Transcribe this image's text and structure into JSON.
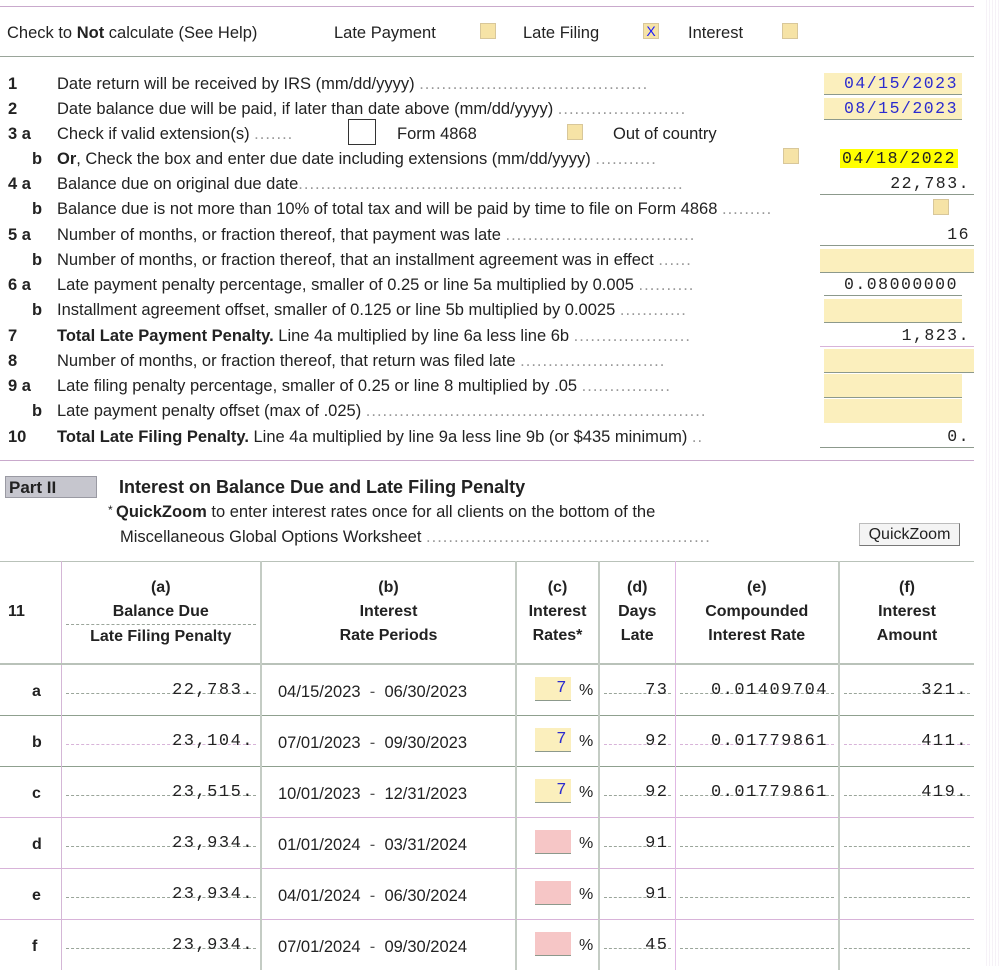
{
  "top_options": {
    "label_prefix": "Check to ",
    "label_bold": "Not",
    "label_suffix": " calculate (See Help)",
    "late_payment": {
      "label": "Late Payment",
      "checked": false,
      "mark": ""
    },
    "late_filing": {
      "label": "Late Filing",
      "checked": true,
      "mark": "X"
    },
    "interest": {
      "label": "Interest",
      "checked": false,
      "mark": ""
    }
  },
  "lines": {
    "l1": {
      "num": "1",
      "text": "Date return will be received by IRS (mm/dd/yyyy)",
      "value": "04/15/2023"
    },
    "l2": {
      "num": "2",
      "text": "Date balance due will be paid, if later than date above (mm/dd/yyyy)",
      "value": "08/15/2023"
    },
    "l3a": {
      "num": "3 a",
      "text": "Check if valid extension(s)",
      "form4868": "Form 4868",
      "out_of_country": "Out of country"
    },
    "l3b": {
      "num": "b",
      "text_bold": "Or",
      "text": ", Check the box and enter due date including extensions (mm/dd/yyyy)",
      "value": "04/18/2022"
    },
    "l4a": {
      "num": "4 a",
      "text": "Balance due on original due date",
      "value": "22,783."
    },
    "l4b": {
      "num": "b",
      "text": "Balance due is not more than 10% of total tax and will be paid by time to file on Form 4868"
    },
    "l5a": {
      "num": "5 a",
      "text": "Number of months, or fraction thereof, that payment was late",
      "value": "16"
    },
    "l5b": {
      "num": "b",
      "text": "Number of months, or fraction thereof, that an installment agreement was in effect",
      "value": ""
    },
    "l6a": {
      "num": "6 a",
      "text": "Late payment penalty percentage, smaller of 0.25 or line 5a multiplied by 0.005",
      "value": "0.08000000"
    },
    "l6b": {
      "num": "b",
      "text": "Installment agreement offset, smaller of 0.125 or line 5b multiplied by 0.0025",
      "value": ""
    },
    "l7": {
      "num": "7",
      "text_bold": "Total Late Payment Penalty.",
      "text": " Line 4a multiplied by line 6a less line 6b",
      "value": "1,823."
    },
    "l8": {
      "num": "8",
      "text": "Number of months, or fraction thereof, that return was filed late",
      "value": ""
    },
    "l9a": {
      "num": "9 a",
      "text": "Late filing penalty percentage,  smaller of 0.25 or line 8 multiplied by .05",
      "value": ""
    },
    "l9b": {
      "num": "b",
      "text": "Late payment penalty offset (max of .025)",
      "value": ""
    },
    "l10": {
      "num": "10",
      "text_bold": "Total Late Filing Penalty.",
      "text": " Line 4a multiplied by line 9a less line 9b (or $435 minimum)",
      "value": "0."
    }
  },
  "part2": {
    "label": "Part II",
    "title": "Interest on Balance Due and Late Filing Penalty",
    "note_star": "* ",
    "note_bold": "QuickZoom",
    "note_line1": " to enter interest rates once for all clients on the bottom of the",
    "note_line2": "Miscellaneous Global Options Worksheet",
    "quickzoom_button": "QuickZoom"
  },
  "table": {
    "line_num": "11",
    "headers": {
      "a": {
        "letter": "(a)",
        "line1": "Balance Due",
        "line2": "Late Filing Penalty"
      },
      "b": {
        "letter": "(b)",
        "line1": "Interest",
        "line2": "Rate Periods"
      },
      "c": {
        "letter": "(c)",
        "line1": "Interest",
        "line2": "Rates*"
      },
      "d": {
        "letter": "(d)",
        "line1": "Days",
        "line2": "Late"
      },
      "e": {
        "letter": "(e)",
        "line1": "Compounded",
        "line2": "Interest Rate"
      },
      "f": {
        "letter": "(f)",
        "line1": "Interest",
        "line2": "Amount"
      }
    },
    "rows": [
      {
        "label": "a",
        "balance": "22,783.",
        "period_start": "04/15/2023",
        "period_end": "06/30/2023",
        "rate": "7",
        "days": "73",
        "compounded": "0.01409704",
        "amount": "321."
      },
      {
        "label": "b",
        "balance": "23,104.",
        "period_start": "07/01/2023",
        "period_end": "09/30/2023",
        "rate": "7",
        "days": "92",
        "compounded": "0.01779861",
        "amount": "411."
      },
      {
        "label": "c",
        "balance": "23,515.",
        "period_start": "10/01/2023",
        "period_end": "12/31/2023",
        "rate": "7",
        "days": "92",
        "compounded": "0.01779861",
        "amount": "419."
      },
      {
        "label": "d",
        "balance": "23,934.",
        "period_start": "01/01/2024",
        "period_end": "03/31/2024",
        "rate": "",
        "days": "91",
        "compounded": "",
        "amount": ""
      },
      {
        "label": "e",
        "balance": "23,934.",
        "period_start": "04/01/2024",
        "period_end": "06/30/2024",
        "rate": "",
        "days": "91",
        "compounded": "",
        "amount": ""
      },
      {
        "label": "f",
        "balance": "23,934.",
        "period_start": "07/01/2024",
        "period_end": "09/30/2024",
        "rate": "",
        "days": "45",
        "compounded": "",
        "amount": ""
      }
    ],
    "percent_sign": "%",
    "dash_sep": "-"
  },
  "colors": {
    "input_fill": "#fbefbd",
    "highlight": "#ffff00",
    "missing_fill": "#f6c6c6",
    "user_value": "#2b2bcf"
  }
}
